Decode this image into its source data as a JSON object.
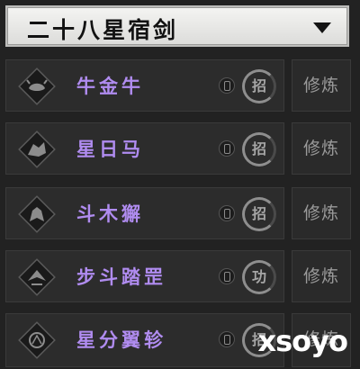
{
  "dropdown": {
    "title": "二十八星宿剑",
    "arrow_icon": "triangle-down-icon"
  },
  "skills": [
    {
      "name": "牛金牛",
      "seal": "招",
      "action": "修炼",
      "icon": "ox-emblem-icon"
    },
    {
      "name": "星日马",
      "seal": "招",
      "action": "修炼",
      "icon": "horse-emblem-icon"
    },
    {
      "name": "斗木獬",
      "seal": "招",
      "action": "修炼",
      "icon": "beast-emblem-icon"
    },
    {
      "name": "步斗踏罡",
      "seal": "功",
      "action": "修炼",
      "icon": "step-emblem-icon"
    },
    {
      "name": "星分翼轸",
      "seal": "招",
      "action": "修炼",
      "icon": "wing-emblem-icon"
    }
  ],
  "colors": {
    "skill_name": "#b08cf0",
    "panel_bg": "#2c2c2c",
    "header_bg": "#e8e8e6"
  },
  "watermark": "xsoyo"
}
